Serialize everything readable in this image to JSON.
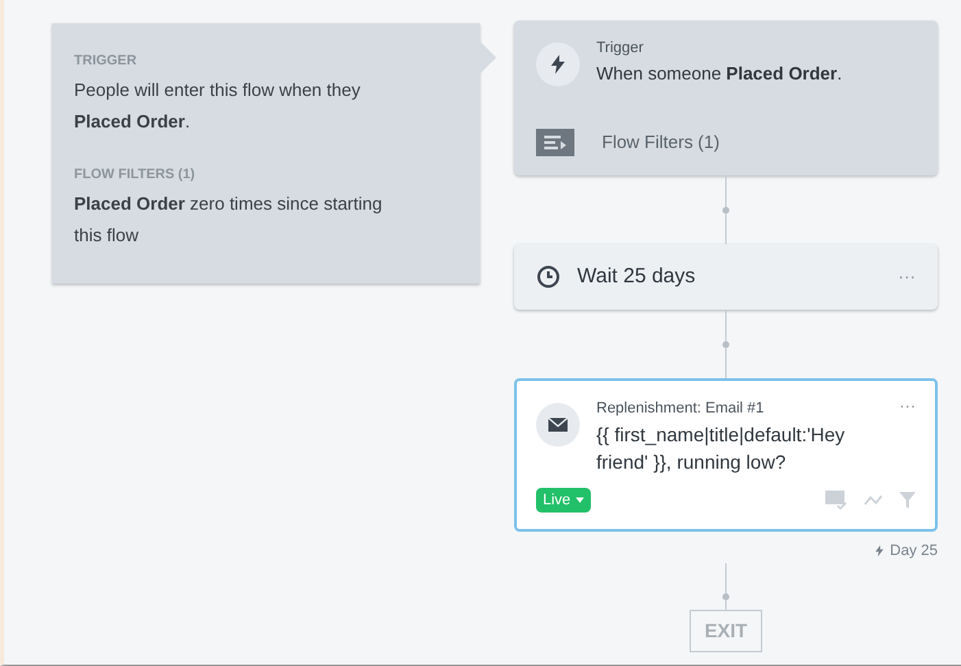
{
  "summary": {
    "sections": [
      {
        "heading": "TRIGGER",
        "text": "People will enter this flow when they **Placed Order**."
      },
      {
        "heading": "FLOW FILTERS (1)",
        "text": "**Placed Order** zero times since starting this flow"
      }
    ]
  },
  "flow": {
    "nodes": [
      {
        "kind": "trigger",
        "label": "Trigger",
        "text": "When someone **Placed Order**.",
        "filters": "Flow Filters (1)"
      },
      {
        "kind": "wait",
        "text": "Wait 25 days",
        "menu": "···"
      },
      {
        "kind": "email",
        "label": "Replenishment: Email #1",
        "text": "{{ first_name|title|default:'Hey friend' }}, running low?",
        "menu": "···",
        "status": "Live",
        "color": "#22c069",
        "selected": true,
        "delay": "Day 25"
      },
      {
        "kind": "exit",
        "text": "EXIT"
      }
    ]
  }
}
